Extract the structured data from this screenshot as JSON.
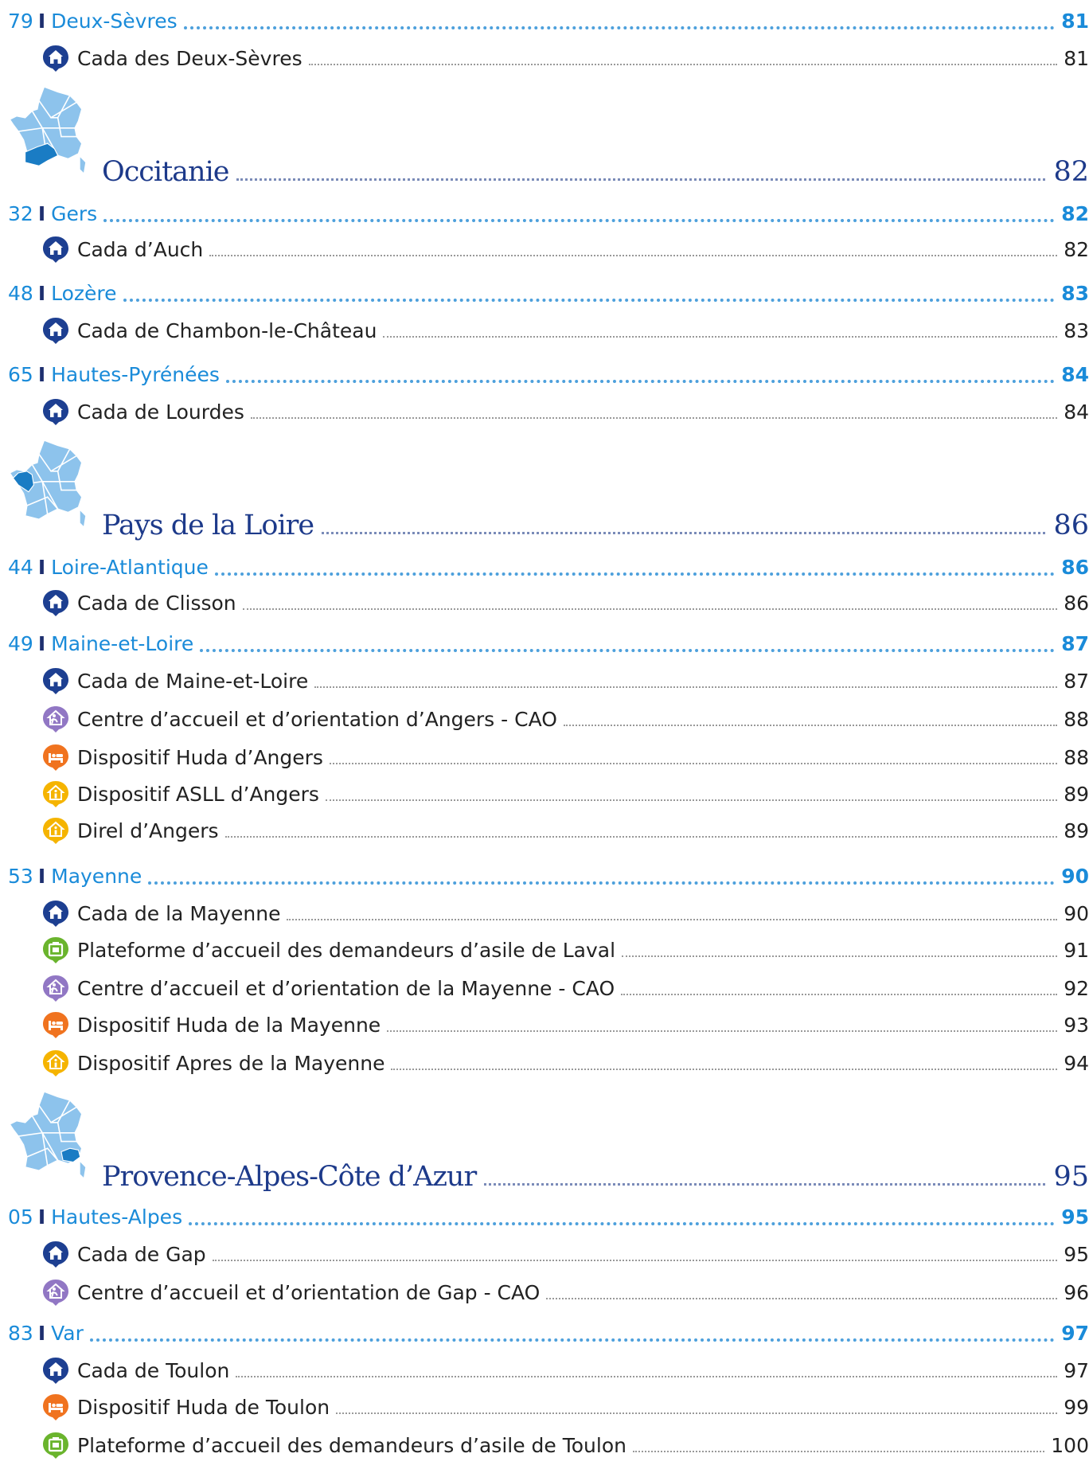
{
  "colors": {
    "department_text": "#1a8bd9",
    "region_text": "#1d3a8a",
    "icon_cada": "#1d3f91",
    "icon_cao": "#9177c4",
    "icon_huda": "#f0731f",
    "icon_asll": "#f5b400",
    "icon_plateforme": "#6ab42d",
    "map_light": "#8dc3ec",
    "map_highlight": "#1a7cc4"
  },
  "toc": [
    {
      "kind": "dept",
      "code": "79",
      "name": "Deux-Sèvres",
      "page": "81"
    },
    {
      "kind": "item",
      "icon": "cada",
      "text": "Cada des Deux-Sèvres",
      "page": "81"
    },
    {
      "kind": "region",
      "map_highlight": "south",
      "name": "Occitanie",
      "page": "82"
    },
    {
      "kind": "dept",
      "code": "32",
      "name": "Gers",
      "page": "82"
    },
    {
      "kind": "item",
      "icon": "cada",
      "text": "Cada d’Auch",
      "page": "82"
    },
    {
      "kind": "dept",
      "code": "48",
      "name": "Lozère",
      "page": "83"
    },
    {
      "kind": "item",
      "icon": "cada",
      "text": "Cada de Chambon-le-Château",
      "page": "83"
    },
    {
      "kind": "dept",
      "code": "65",
      "name": "Hautes-Pyrénées",
      "page": "84"
    },
    {
      "kind": "item",
      "icon": "cada",
      "text": "Cada de Lourdes",
      "page": "84"
    },
    {
      "kind": "region",
      "map_highlight": "west",
      "name": "Pays de la Loire",
      "page": "86"
    },
    {
      "kind": "dept",
      "code": "44",
      "name": "Loire-Atlantique",
      "page": "86"
    },
    {
      "kind": "item",
      "icon": "cada",
      "text": "Cada de Clisson",
      "page": "86"
    },
    {
      "kind": "dept",
      "code": "49",
      "name": "Maine-et-Loire",
      "page": "87"
    },
    {
      "kind": "item",
      "icon": "cada",
      "text": "Cada de Maine-et-Loire",
      "page": "87"
    },
    {
      "kind": "item",
      "icon": "cao",
      "text": "Centre d’accueil et d’orientation d’Angers - CAO",
      "page": "88"
    },
    {
      "kind": "item",
      "icon": "huda",
      "text": "Dispositif Huda d’Angers",
      "page": "88"
    },
    {
      "kind": "item",
      "icon": "asll",
      "text": "Dispositif ASLL d’Angers",
      "page": "89"
    },
    {
      "kind": "item",
      "icon": "asll",
      "text": "Direl d’Angers",
      "page": "89"
    },
    {
      "kind": "dept",
      "code": "53",
      "name": "Mayenne",
      "page": "90"
    },
    {
      "kind": "item",
      "icon": "cada",
      "text": "Cada de la Mayenne",
      "page": "90"
    },
    {
      "kind": "item",
      "icon": "plateforme",
      "text": "Plateforme d’accueil des demandeurs d’asile de Laval",
      "page": "91"
    },
    {
      "kind": "item",
      "icon": "cao",
      "text": "Centre d’accueil et d’orientation de la Mayenne - CAO",
      "page": "92"
    },
    {
      "kind": "item",
      "icon": "huda",
      "text": "Dispositif Huda de la Mayenne",
      "page": "93"
    },
    {
      "kind": "item",
      "icon": "asll",
      "text": "Dispositif Apres de la Mayenne",
      "page": "94"
    },
    {
      "kind": "region",
      "map_highlight": "southeast",
      "name": "Provence-Alpes-Côte d’Azur",
      "page": "95"
    },
    {
      "kind": "dept",
      "code": "05",
      "name": "Hautes-Alpes",
      "page": "95"
    },
    {
      "kind": "item",
      "icon": "cada",
      "text": "Cada de Gap",
      "page": "95"
    },
    {
      "kind": "item",
      "icon": "cao",
      "text": "Centre d’accueil et d’orientation de Gap - CAO",
      "page": "96"
    },
    {
      "kind": "dept",
      "code": "83",
      "name": "Var",
      "page": "97"
    },
    {
      "kind": "item",
      "icon": "cada",
      "text": "Cada de Toulon",
      "page": "97"
    },
    {
      "kind": "item",
      "icon": "huda",
      "text": "Dispositif Huda de Toulon",
      "page": "99"
    },
    {
      "kind": "item",
      "icon": "plateforme",
      "text": "Plateforme d’accueil des demandeurs d’asile de Toulon",
      "page": "100"
    }
  ]
}
